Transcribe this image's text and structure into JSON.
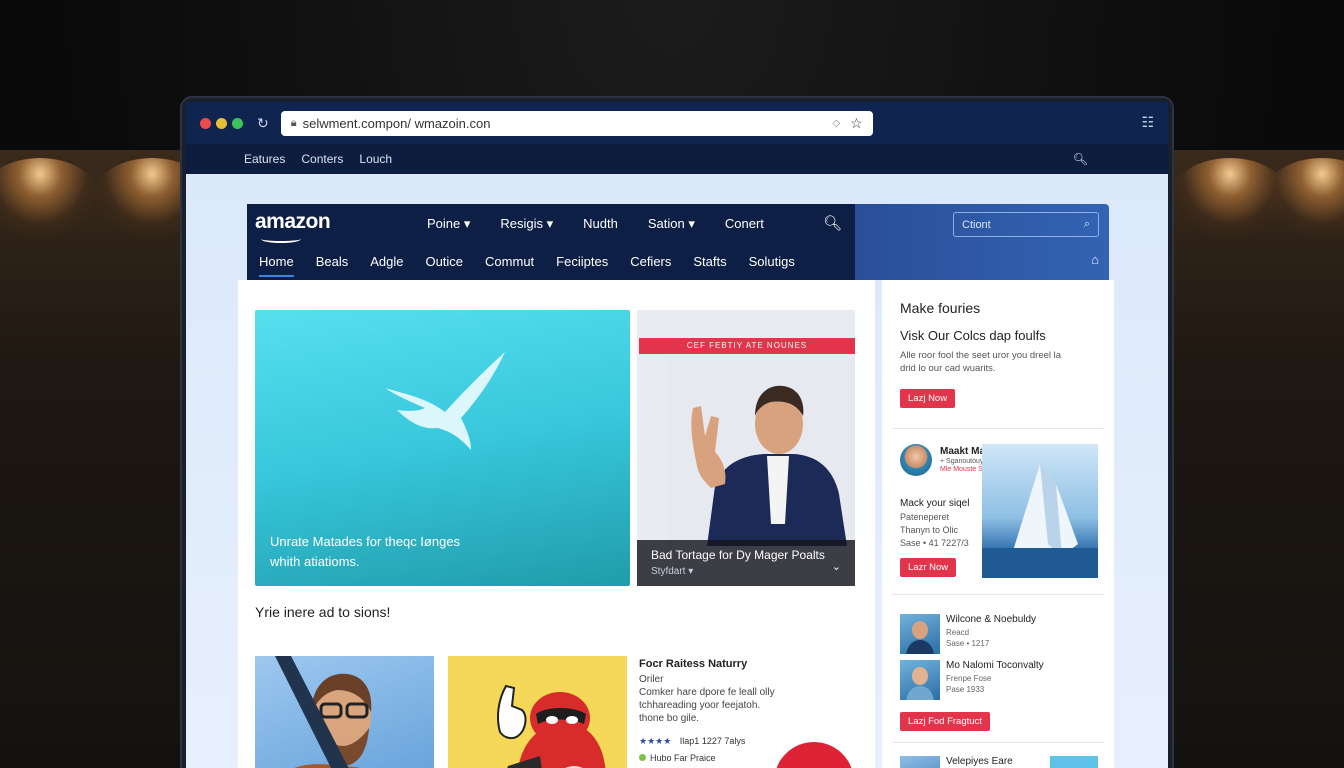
{
  "browser": {
    "url": "selwment.compon/ wmazoin.con",
    "bookmarks": [
      "Eatures",
      "Conters",
      "Louch"
    ]
  },
  "site": {
    "logo": "amazon",
    "nav_top": [
      "Poine ▾",
      "Resigis ▾",
      "Nudth",
      "Sation ▾",
      "Conert"
    ],
    "nav_bottom": [
      "Home",
      "Beals",
      "Adgle",
      "Outice",
      "Commut",
      "Feciiptes",
      "Cefiers",
      "Stafts",
      "Solutigs"
    ],
    "search_placeholder": "Ctiont"
  },
  "hero": {
    "left_caption_line1": "Unrate Matades for theqc Iønges",
    "left_caption_line2": "whith atiatioms.",
    "ribbon": "CEF FEBTIY ATE NOUNES",
    "right_title": "Bad Tortage for Dy Mager Poalts",
    "right_sub": "Styfdart ▾"
  },
  "section": {
    "title": "Yrie inere ad to sions!"
  },
  "article": {
    "title": "Focr Raitess Naturry",
    "sub": "Oriler",
    "desc_line1": "Comker hare dpore fe leall olly",
    "desc_line2": "tchhareading yoor feejatoh.",
    "desc_line3": "thone bo gile.",
    "stars": "★★★★",
    "stars_text": "Ilap1 1227 7alys",
    "tag": "Hubo Far Praice"
  },
  "sidebar": {
    "promo1": {
      "heading": "Make fouries",
      "subheading": "Visk Our Colcs dap foulfs",
      "desc_line1": "Alle roor fool the seet uror you dreel la",
      "desc_line2": "drid lo our cad wuarits.",
      "button": "Lazj Now"
    },
    "promo2": {
      "title": "Maakt Mattle Srelty",
      "line1": "+ Sganoutouy",
      "line2": "Mle Mouste Snahtoots",
      "heading": "Mack your siqel",
      "body_line1": "Pateneperet",
      "body_line2": "Thanyn to Olic",
      "body_line3": "Sase • 41 7227/3",
      "button": "Lazr Now"
    },
    "list": [
      {
        "name": "Wilcone & Noebuldy",
        "meta1": "Reacd",
        "meta2": "Sase • 1217"
      },
      {
        "name": "Mo Nalomi Toconvalty",
        "meta1": "Frenpe Fose",
        "meta2": "Pase 1933"
      }
    ],
    "list_button": "Lazj Fod Fragtuct",
    "bottom_item": "Velepiyes Eare"
  },
  "colors": {
    "brand_dark": "#0d1f45",
    "accent_red": "#e2354c",
    "hero_teal": "#37c6dc"
  }
}
